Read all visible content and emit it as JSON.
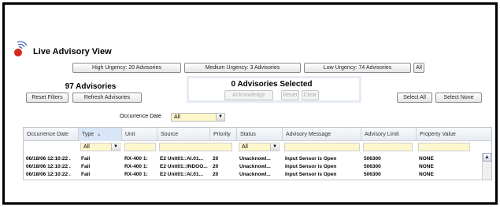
{
  "app": {
    "title": "Live Advisory View",
    "logo_icon": "satellite-dish-icon"
  },
  "urgency_buttons": {
    "high": "High Urgency: 20 Advisories",
    "medium": "Medium Urgency: 3 Advisories",
    "low": "Low Urgency: 74 Advisories",
    "all": "All"
  },
  "advisories": {
    "count_label": "97 Advisories",
    "reset_filters": "Reset Filters",
    "refresh": "Refresh Advisories"
  },
  "selection": {
    "count_label": "0 Advisories Selected",
    "acknowledge": "Acknowledge",
    "reset": "Reset",
    "clear": "Clear",
    "select_all": "Select All",
    "select_none": "Select None"
  },
  "occurrence_filter": {
    "label": "Occurrence Date",
    "value": "All"
  },
  "grid": {
    "columns": [
      "Occurrence Date",
      "Type",
      "Unit",
      "Source",
      "Priority",
      "Status",
      "Advisory Message",
      "Advisory Limit",
      "Property Value"
    ],
    "sort_indicator": "▲",
    "filters": {
      "type": "All",
      "status": "All"
    },
    "rows": [
      [
        "06/18/06 12:10:22 .",
        "Fail",
        "RX-400 1:",
        "E2 Unit01::AI.01...",
        "20",
        "Unacknowl...",
        "Input Sensor is Open",
        "506300",
        "NONE"
      ],
      [
        "06/18/06 12:10:22 .",
        "Fail",
        "RX-400 1:",
        "E2 Unit01::INDOO...",
        "20",
        "Unacknowl...",
        "Input Sensor is Open",
        "506300",
        "NONE"
      ],
      [
        "06/18/06 12:10:22 .",
        "Fail",
        "RX-400 1:",
        "E2 Unit01::AI.01...",
        "20",
        "Unacknowl...",
        "Input Sensor is Open",
        "506300",
        "NONE"
      ]
    ]
  },
  "colors": {
    "filter_bg": "#fff7cc",
    "header_bg": "#e8ecf2",
    "logo_red": "#d42a1c",
    "logo_blue": "#3a5fb8"
  }
}
